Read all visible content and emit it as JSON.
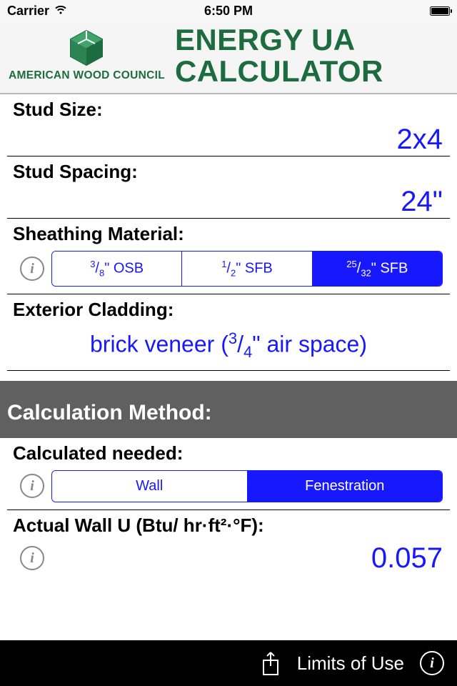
{
  "status_bar": {
    "carrier": "Carrier",
    "time": "6:50 PM"
  },
  "header": {
    "logo_text": "AMERICAN WOOD COUNCIL",
    "title_line1": "ENERGY UA",
    "title_line2": "CALCULATOR"
  },
  "stud_size": {
    "label": "Stud Size:",
    "value": "2x4"
  },
  "stud_spacing": {
    "label": "Stud Spacing:",
    "value": "24\""
  },
  "sheathing": {
    "label": "Sheathing Material:",
    "options": [
      {
        "num": "3",
        "den": "8",
        "suffix": "\" OSB",
        "selected": false
      },
      {
        "num": "1",
        "den": "2",
        "suffix": "\" SFB",
        "selected": false
      },
      {
        "num": "25",
        "den": "32",
        "suffix": "\" SFB",
        "selected": true
      }
    ]
  },
  "cladding": {
    "label": "Exterior Cladding:",
    "value_pre": "brick veneer (",
    "value_num": "3",
    "value_den": "4",
    "value_post": "\" air space)"
  },
  "calc_method": {
    "header": "Calculation Method:",
    "needed_label": "Calculated needed:",
    "options": [
      {
        "label": "Wall",
        "selected": false
      },
      {
        "label": "Fenestration",
        "selected": true
      }
    ]
  },
  "actual_u": {
    "label": "Actual Wall U (Btu/ hr·ft²·°F):",
    "value": "0.057"
  },
  "footer": {
    "limits": "Limits of Use"
  }
}
